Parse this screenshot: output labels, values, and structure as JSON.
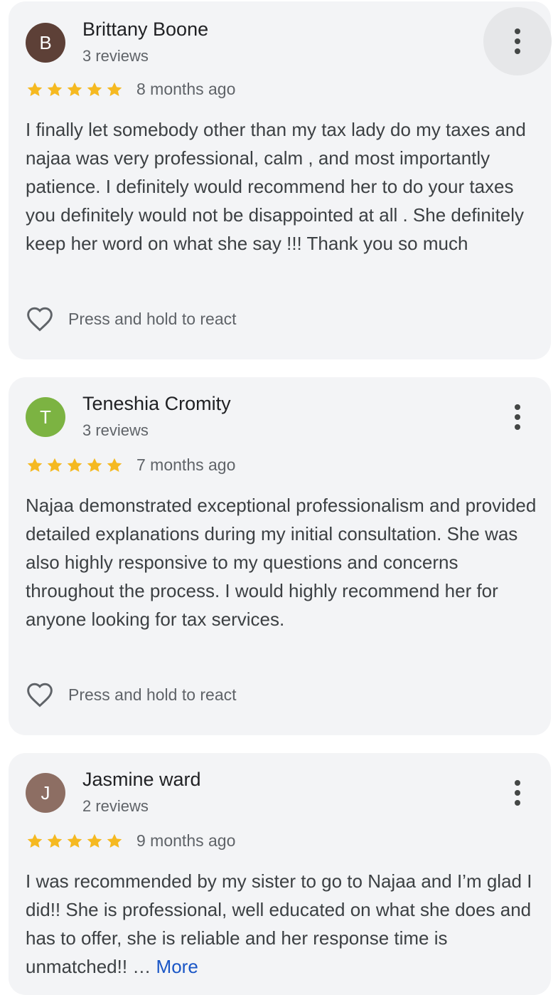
{
  "reviews": [
    {
      "author": "Brittany Boone",
      "initial": "B",
      "avatar_color": "#5d4037",
      "review_count": "3 reviews",
      "rating": 5,
      "time": "8 months ago",
      "text": "I finally let somebody other than my tax lady do my taxes and najaa was very professional, calm , and most importantly patience. I definitely would recommend her to do your taxes you definitely would not be disappointed at all . She definitely keep her word on what she say !!! Thank you so much",
      "react_label": "Press and hold to react"
    },
    {
      "author": "Teneshia Cromity",
      "initial": "T",
      "avatar_color": "#7cb342",
      "review_count": "3 reviews",
      "rating": 5,
      "time": "7 months ago",
      "text": "Najaa demonstrated exceptional professionalism and provided detailed explanations during my initial consultation. She was also highly responsive to my questions and concerns throughout the process. I would highly recommend her for anyone looking for tax services.",
      "react_label": "Press and hold to react"
    },
    {
      "author": "Jasmine ward",
      "initial": "J",
      "avatar_color": "#8d6e63",
      "review_count": "2 reviews",
      "rating": 5,
      "time": "9 months ago",
      "text": "I was recommended by my sister to go to Najaa and I’m glad I did!! She is professional, well educated on what she does and has to offer, she is reliable and her response time is unmatched!! …",
      "more_label": "More"
    }
  ],
  "colors": {
    "star": "#f5b921",
    "link": "#1a56c6",
    "card_bg": "#f3f4f6"
  }
}
